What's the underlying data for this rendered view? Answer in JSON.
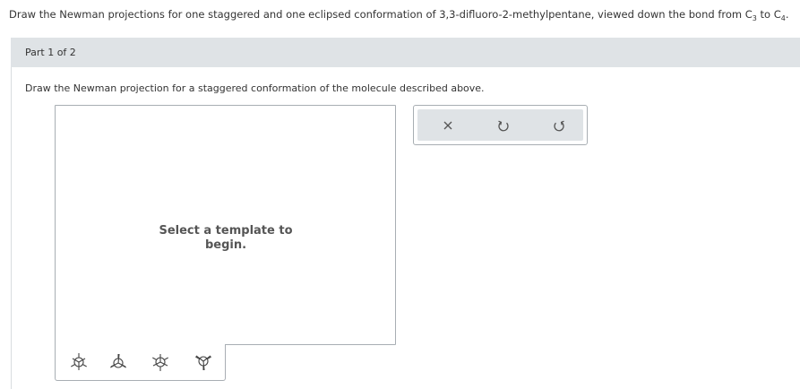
{
  "question": {
    "prefix": "Draw the Newman projections for one staggered and one eclipsed conformation of 3,3-difluoro-2-methylpentane, viewed down the bond from C",
    "sub1": "3",
    "middle": " to C",
    "sub2": "4",
    "suffix": "."
  },
  "part": {
    "label": "Part 1 of 2"
  },
  "prompt": "Draw the Newman projection for a staggered conformation of the molecule described above.",
  "canvas": {
    "message_line1": "Select a template to",
    "message_line2": "begin."
  },
  "toolbar": {
    "icons": [
      "close-icon",
      "undo-icon",
      "redo-icon"
    ]
  },
  "templates": {
    "icons": [
      "newman-staggered-template-icon",
      "newman-eclipsed-template-icon",
      "newman-staggered-alt-template-icon",
      "newman-eclipsed-alt-template-icon"
    ]
  },
  "colors": {
    "part_bar": "#dfe3e6",
    "border": "#a8aeb3",
    "text": "#333333"
  }
}
